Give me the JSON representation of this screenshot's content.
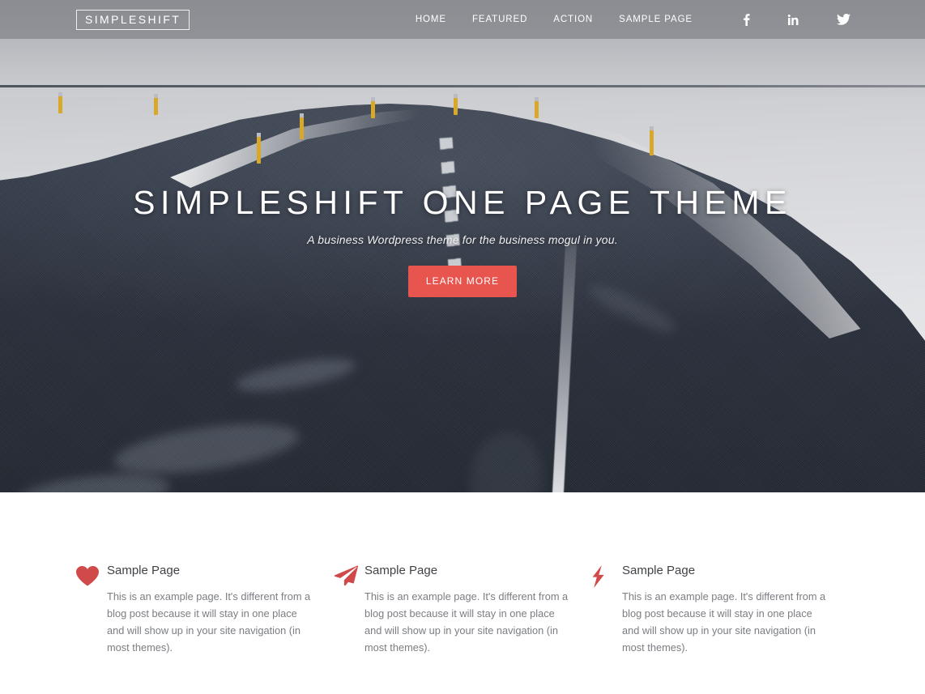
{
  "header": {
    "logo": "SIMPLESHIFT",
    "nav": [
      {
        "label": "HOME",
        "name": "nav-home"
      },
      {
        "label": "FEATURED",
        "name": "nav-featured"
      },
      {
        "label": "ACTION",
        "name": "nav-action"
      },
      {
        "label": "SAMPLE PAGE",
        "name": "nav-sample-page"
      }
    ],
    "socials": [
      {
        "label": "Facebook",
        "icon": "facebook-icon"
      },
      {
        "label": "LinkedIn",
        "icon": "linkedin-icon"
      },
      {
        "label": "Twitter",
        "icon": "twitter-icon"
      }
    ]
  },
  "hero": {
    "title": "SIMPLESHIFT ONE PAGE THEME",
    "subtitle": "A business Wordpress theme for the business mogul in you.",
    "button": "LEARN MORE",
    "image_alt": "Snowy road through winter landscape",
    "accent_color": "#e8544e",
    "overlay_color": "rgba(120,122,128,0.62)"
  },
  "features": {
    "icon_color": "#d04a4a",
    "row1": [
      {
        "icon": "heart-icon",
        "title": "Sample Page",
        "text": "This is an example page. It's different from a blog post because it will stay in one place and will show up in your site navigation (in most themes)."
      },
      {
        "icon": "paper-plane-icon",
        "title": "Sample Page",
        "text": "This is an example page. It's different from a blog post because it will stay in one place and will show up in your site navigation (in most themes)."
      },
      {
        "icon": "lightning-bolt-icon",
        "title": "Sample Page",
        "text": "This is an example page. It's different from a blog post because it will stay in one place and will show up in your site navigation (in most themes)."
      }
    ]
  }
}
